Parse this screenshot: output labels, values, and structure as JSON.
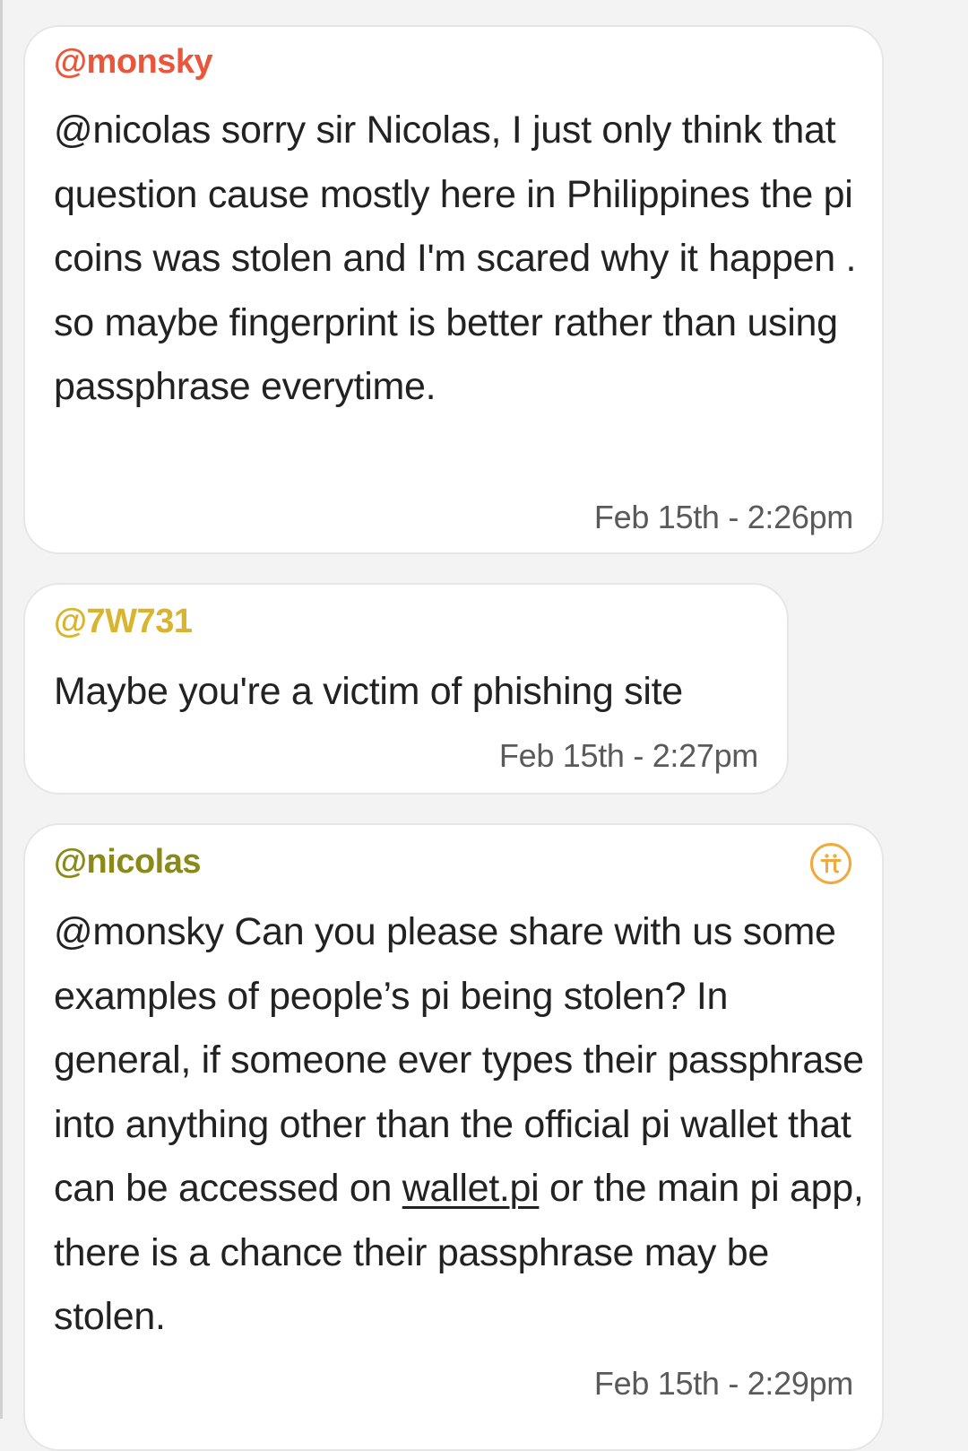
{
  "messages": [
    {
      "sender": "@monsky",
      "sender_color": "#e8563c",
      "text": "@nicolas sorry sir Nicolas, I just only think that question cause mostly here in Philippines the pi coins was stolen and I'm scared why it happen . so maybe fingerprint is better rather than using passphrase everytime.",
      "timestamp": "Feb 15th - 2:26pm"
    },
    {
      "sender": "@7W731",
      "sender_color": "#d9b42e",
      "text": "Maybe you're a victim of phishing site",
      "timestamp": "Feb 15th - 2:27pm"
    },
    {
      "sender": "@nicolas",
      "sender_color": "#8a8a1a",
      "badge_icon": "pi-logo-icon",
      "badge_color": "#f2a93b",
      "text_before_link": "@monsky Can you please share with us some examples of people’s pi being stolen? In general, if someone ever types their passphrase into anything other than the official pi wallet that can be accessed on ",
      "link_text": "wallet.pi",
      "text_after_link": " or the main pi app, there is a chance their passphrase may be stolen.",
      "timestamp": "Feb 15th - 2:29pm"
    }
  ]
}
